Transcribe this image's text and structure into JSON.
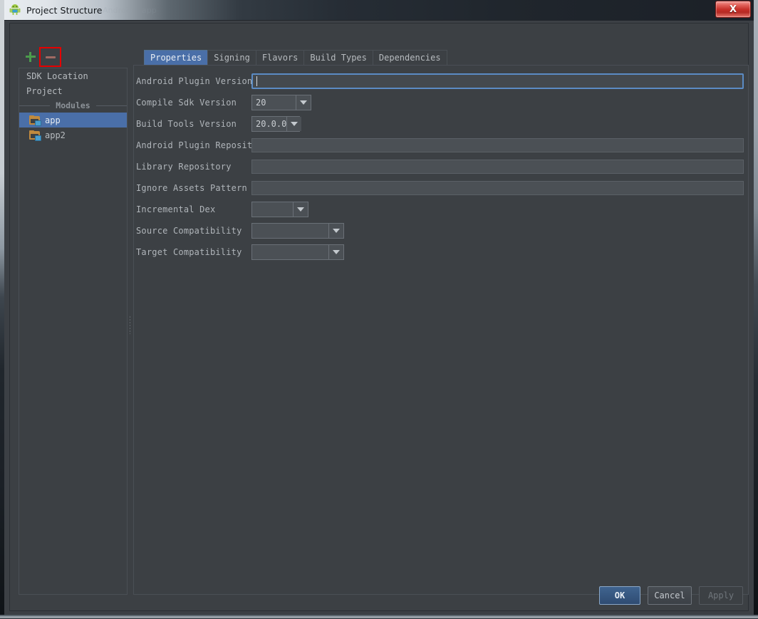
{
  "window": {
    "title": "Project Structure",
    "app_icon": "android-robot-icon",
    "close_label": "X",
    "ghost_text_1": "Android",
    "ghost_text_2": "app"
  },
  "toolbar": {
    "add_label": "+",
    "remove_label": "−",
    "highlight_color": "#e60000"
  },
  "sidebar": {
    "items": [
      {
        "label": "SDK Location",
        "type": "item",
        "selected": false
      },
      {
        "label": "Project",
        "type": "item",
        "selected": false
      },
      {
        "label": "Modules",
        "type": "separator"
      },
      {
        "label": "app",
        "type": "module",
        "selected": true
      },
      {
        "label": "app2",
        "type": "module",
        "selected": false
      }
    ]
  },
  "tabs": [
    {
      "label": "Properties",
      "active": true
    },
    {
      "label": "Signing",
      "active": false
    },
    {
      "label": "Flavors",
      "active": false
    },
    {
      "label": "Build Types",
      "active": false
    },
    {
      "label": "Dependencies",
      "active": false
    }
  ],
  "form": {
    "rows": [
      {
        "label": "Android Plugin Version",
        "control": "text-focused",
        "value": "",
        "width": "wide"
      },
      {
        "label": "Compile Sdk Version",
        "control": "combo",
        "value": "20",
        "width": "w-compile"
      },
      {
        "label": "Build Tools Version",
        "control": "combo",
        "value": "20.0.0",
        "width": "w-buildtools"
      },
      {
        "label": "Android Plugin Repository",
        "control": "text",
        "value": "",
        "width": "wide"
      },
      {
        "label": "Library Repository",
        "control": "text",
        "value": "",
        "width": "wide"
      },
      {
        "label": "Ignore Assets Pattern",
        "control": "text",
        "value": "",
        "width": "wide"
      },
      {
        "label": "Incremental Dex",
        "control": "combo",
        "value": "",
        "width": "w-incdex"
      },
      {
        "label": "Source Compatibility",
        "control": "combo",
        "value": "",
        "width": "w-compat"
      },
      {
        "label": "Target Compatibility",
        "control": "combo",
        "value": "",
        "width": "w-compat"
      }
    ]
  },
  "buttons": {
    "ok": "OK",
    "cancel": "Cancel",
    "apply": "Apply"
  },
  "colors": {
    "accent_selection": "#4a6fa8",
    "panel_bg": "#3c4044",
    "focus_border": "#5b8bc4",
    "highlight_annotation": "#e60000",
    "close_button": "#c62f28"
  }
}
